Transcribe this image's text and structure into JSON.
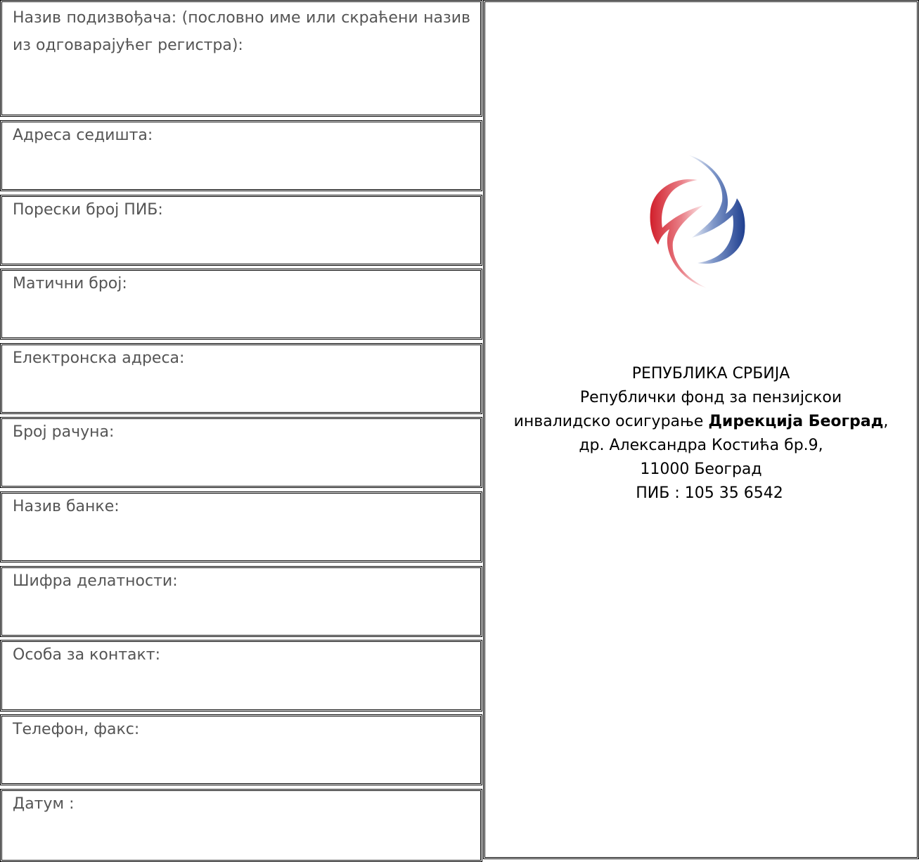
{
  "form": {
    "fields": [
      {
        "label": "Назив подизвођача: (пословно име или скраћени назив из одговарајућег регистра):"
      },
      {
        "label": "Адреса седишта:"
      },
      {
        "label": "Порески број ПИБ:"
      },
      {
        "label": "Матични број:"
      },
      {
        "label": "Електронска адреса:"
      },
      {
        "label": "Број рачуна:"
      },
      {
        "label": "Назив банке:"
      },
      {
        "label": "Шифра делатности:"
      },
      {
        "label": "Особа за контакт:"
      },
      {
        "label": "Телефон, факс:"
      },
      {
        "label": "Датум :"
      }
    ]
  },
  "organization": {
    "logo_icon": "pension-fund-logo-icon",
    "logo_colors": {
      "blue": "#1f3f8f",
      "red": "#d11f2b"
    },
    "country": "РЕПУБЛИКА СРБИЈА",
    "fund_line": "Републички фонд за пензијскои",
    "insurance_prefix": "инвалидско осигурање ",
    "directorate": "Дирекција Београд",
    "insurance_suffix": ",",
    "street": "др. Александра Костића бр.9,",
    "postal_city": "11000 Београд",
    "pib": "ПИБ : 105 35 6542"
  }
}
